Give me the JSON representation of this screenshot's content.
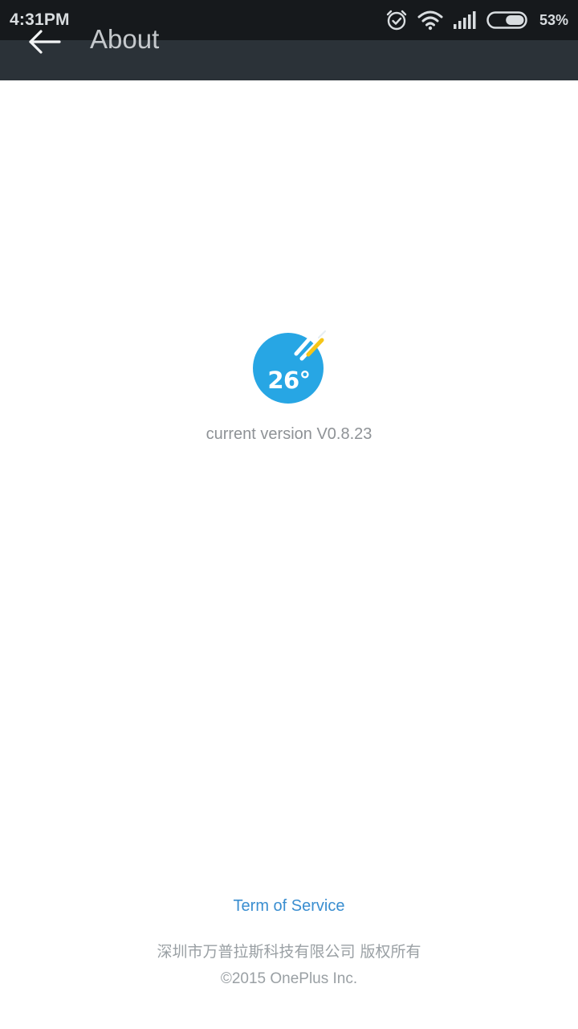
{
  "status_bar": {
    "time": "4:31PM",
    "battery_percent": "53%",
    "battery_level": 0.53,
    "icons": [
      "alarm-icon",
      "wifi-icon",
      "cell-signal-icon",
      "battery-icon"
    ]
  },
  "app_bar": {
    "back_icon": "arrow-left-icon",
    "title": "About"
  },
  "logo": {
    "temperature": "26°",
    "colors": {
      "circle": "#27a6e4",
      "streak_white": "#ffffff",
      "streak_yellow": "#f5c518"
    }
  },
  "version_text": "current version V0.8.23",
  "links": {
    "terms": "Term of Service"
  },
  "footer": {
    "copyright_cn": "深圳市万普拉斯科技有限公司 版权所有",
    "copyright_en": "©2015 OnePlus Inc."
  },
  "colors": {
    "app_bar": "#2b3238",
    "status_bar": "#16191c",
    "link": "#3a8ed0",
    "muted_text": "#8e9296"
  }
}
